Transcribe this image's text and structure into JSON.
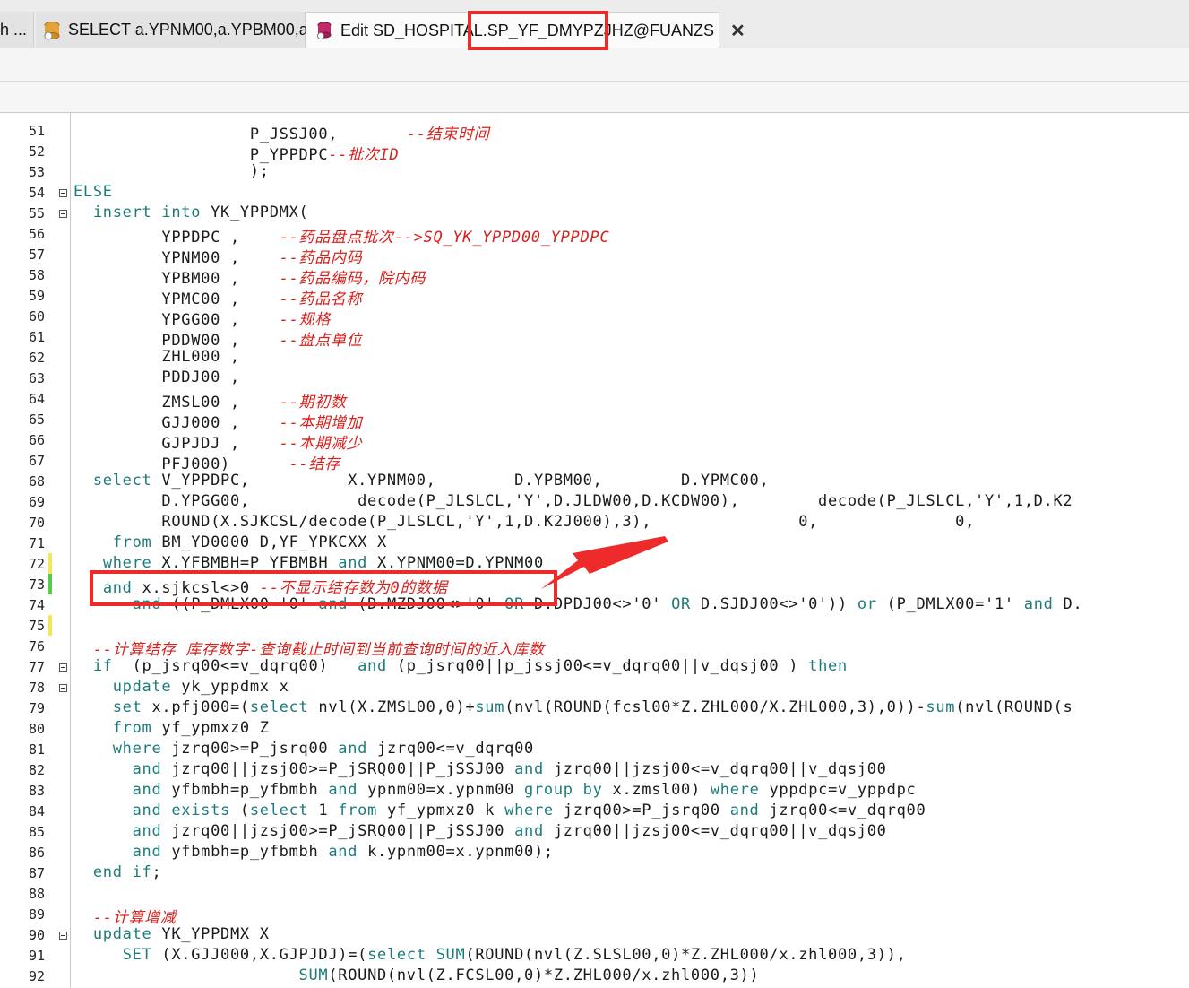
{
  "tabs": [
    {
      "label": "h ...",
      "active": false
    },
    {
      "label": "SELECT a.YPNM00,a.YPBM00,a ...",
      "active": false,
      "icon": "database-script-icon"
    },
    {
      "label": "Edit SD_HOSPITAL.SP_YF_DMYPZJHZ@FUANZS",
      "active": true,
      "icon": "procedure-edit-icon",
      "close": "✕"
    }
  ],
  "colors": {
    "keyword": "#1e7b7b",
    "comment": "#d8201c",
    "highlight": "#ee2b2b"
  },
  "lines": [
    {
      "n": "51",
      "indent": "                  ",
      "code": "P_JSSJ00,       ",
      "comment": "--结束时间"
    },
    {
      "n": "52",
      "indent": "                  ",
      "code": "P_YPPDPC",
      "comment": "--批次ID"
    },
    {
      "n": "53",
      "indent": "                  ",
      "code": ");",
      "comment": ""
    },
    {
      "n": "54",
      "indent": "",
      "code": "ELSE",
      "comment": "",
      "fold": true,
      "kw": true
    },
    {
      "n": "55",
      "indent": "  ",
      "code": "insert into YK_YPPDMX(",
      "comment": "",
      "fold": true,
      "kwprefix": "insert into"
    },
    {
      "n": "56",
      "indent": "         ",
      "code": "YPPDPC ,    ",
      "comment": "--药品盘点批次-->SQ_YK_YPPD00_YPPDPC"
    },
    {
      "n": "57",
      "indent": "         ",
      "code": "YPNM00 ,    ",
      "comment": "--药品内码"
    },
    {
      "n": "58",
      "indent": "         ",
      "code": "YPBM00 ,    ",
      "comment": "--药品编码，院内码"
    },
    {
      "n": "59",
      "indent": "         ",
      "code": "YPMC00 ,    ",
      "comment": "--药品名称"
    },
    {
      "n": "60",
      "indent": "         ",
      "code": "YPGG00 ,    ",
      "comment": "--规格"
    },
    {
      "n": "61",
      "indent": "         ",
      "code": "PDDW00 ,    ",
      "comment": "--盘点单位"
    },
    {
      "n": "62",
      "indent": "         ",
      "code": "ZHL000 ,",
      "comment": ""
    },
    {
      "n": "63",
      "indent": "         ",
      "code": "PDDJ00 ,",
      "comment": ""
    },
    {
      "n": "64",
      "indent": "         ",
      "code": "ZMSL00 ,    ",
      "comment": "--期初数"
    },
    {
      "n": "65",
      "indent": "         ",
      "code": "GJJ000 ,    ",
      "comment": "--本期增加"
    },
    {
      "n": "66",
      "indent": "         ",
      "code": "GJPJDJ ,    ",
      "comment": "--本期减少"
    },
    {
      "n": "67",
      "indent": "         ",
      "code": "PFJ000)      ",
      "comment": "--结存"
    },
    {
      "n": "68",
      "indent": "  ",
      "code": "select V_YPPDPC,          X.YPNM00,        D.YPBM00,        D.YPMC00,",
      "comment": "",
      "kwprefix": "select"
    },
    {
      "n": "69",
      "indent": "         ",
      "code": "D.YPGG00,           decode(P_JLSLCL,'Y',D.JLDW00,D.KCDW00),        decode(P_JLSLCL,'Y',1,D.K2",
      "comment": ""
    },
    {
      "n": "70",
      "indent": "         ",
      "code": "ROUND(X.SJKCSL/decode(P_JLSLCL,'Y',1,D.K2J000),3),               0,              0,",
      "comment": ""
    },
    {
      "n": "71",
      "indent": "    ",
      "code": "from BM_YD0000 D,YF_YPKCXX X",
      "comment": "",
      "kwprefix": "from"
    },
    {
      "n": "72",
      "indent": "   ",
      "code": "where X.YFBMBH=P_YFBMBH and X.YPNM00=D.YPNM00",
      "comment": "",
      "kwprefix": "where"
    },
    {
      "n": "73",
      "indent": "   ",
      "code": "and x.sjkcsl<>0 ",
      "comment": "--不显示结存数为0的数据",
      "kwprefix": "and"
    },
    {
      "n": "74",
      "indent": "      ",
      "code": "and ((P_DMLX00='0' and (D.MZDJ00<>'0' OR D.DPDJ00<>'0' OR D.SJDJ00<>'0')) or (P_DMLX00='1' and D.",
      "comment": "",
      "kwprefix": "and"
    },
    {
      "n": "75",
      "indent": "",
      "code": "",
      "comment": ""
    },
    {
      "n": "76",
      "indent": "  ",
      "code": "",
      "comment": "--计算结存 库存数字-查询截止时间到当前查询时间的近入库数"
    },
    {
      "n": "77",
      "indent": "  ",
      "code": "if  (p_jsrq00<=v_dqrq00)   and (p_jsrq00||p_jssj00<=v_dqrq00||v_dqsj00 ) then",
      "comment": "",
      "fold": true,
      "kwprefix": "if"
    },
    {
      "n": "78",
      "indent": "    ",
      "code": "update yk_yppdmx x",
      "comment": "",
      "fold": true,
      "kwprefix": "update"
    },
    {
      "n": "79",
      "indent": "    ",
      "code": "set x.pfj000=(select nvl(X.ZMSL00,0)+sum(nvl(ROUND(fcsl00*Z.ZHL000/X.ZHL000,3),0))-sum(nvl(ROUND(s",
      "comment": "",
      "kwprefix": "set"
    },
    {
      "n": "80",
      "indent": "    ",
      "code": "from yf_ypmxz0 Z",
      "comment": "",
      "kwprefix": "from"
    },
    {
      "n": "81",
      "indent": "    ",
      "code": "where jzrq00>=P_jsrq00 and jzrq00<=v_dqrq00",
      "comment": "",
      "kwprefix": "where"
    },
    {
      "n": "82",
      "indent": "      ",
      "code": "and jzrq00||jzsj00>=P_jSRQ00||P_jSSJ00 and jzrq00||jzsj00<=v_dqrq00||v_dqsj00",
      "comment": "",
      "kwprefix": "and"
    },
    {
      "n": "83",
      "indent": "      ",
      "code": "and yfbmbh=p_yfbmbh and ypnm00=x.ypnm00 group by x.zmsl00) where yppdpc=v_yppdpc",
      "comment": "",
      "kwprefix": "and"
    },
    {
      "n": "84",
      "indent": "      ",
      "code": "and exists (select 1 from yf_ypmxz0 k where jzrq00>=P_jsrq00 and jzrq00<=v_dqrq00",
      "comment": "",
      "kwprefix": "and"
    },
    {
      "n": "85",
      "indent": "      ",
      "code": "and jzrq00||jzsj00>=P_jSRQ00||P_jSSJ00 and jzrq00||jzsj00<=v_dqrq00||v_dqsj00",
      "comment": "",
      "kwprefix": "and"
    },
    {
      "n": "86",
      "indent": "      ",
      "code": "and yfbmbh=p_yfbmbh and k.ypnm00=x.ypnm00);",
      "comment": "",
      "kwprefix": "and"
    },
    {
      "n": "87",
      "indent": "  ",
      "code": "end if;",
      "comment": "",
      "kwprefix": "end if"
    },
    {
      "n": "88",
      "indent": "",
      "code": "",
      "comment": ""
    },
    {
      "n": "89",
      "indent": "  ",
      "code": "",
      "comment": "--计算增减"
    },
    {
      "n": "90",
      "indent": "  ",
      "code": "update YK_YPPDMX X",
      "comment": "",
      "fold": true,
      "kwprefix": "update"
    },
    {
      "n": "91",
      "indent": "     ",
      "code": "SET (X.GJJ000,X.GJPJDJ)=(select SUM(ROUND(nvl(Z.SLSL00,0)*Z.ZHL000/x.zhl000,3)),",
      "comment": "",
      "kwprefix": "SET"
    },
    {
      "n": "92",
      "indent": "                       ",
      "code": "SUM(ROUND(nvl(Z.FCSL00,0)*Z.ZHL000/x.zhl000,3))",
      "comment": ""
    }
  ]
}
